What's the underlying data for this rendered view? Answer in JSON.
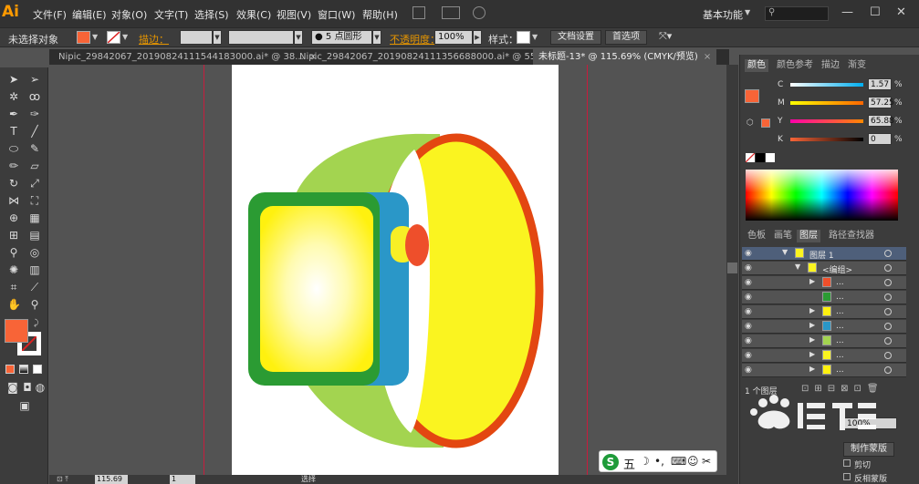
{
  "app": {
    "logo": "Ai"
  },
  "menu": [
    "文件(F)",
    "编辑(E)",
    "对象(O)",
    "文字(T)",
    "选择(S)",
    "效果(C)",
    "视图(V)",
    "窗口(W)",
    "帮助(H)"
  ],
  "workspace": "基本功能",
  "control": {
    "no_selection": "未选择对象",
    "stroke_label": "描边：",
    "brush_value": "5 点圆形",
    "opacity_label": "不透明度：",
    "opacity_value": "100%",
    "style_label": "样式：",
    "doc_settings": "文档设置",
    "preferences": "首选项"
  },
  "tabs": [
    {
      "label": "Nipic_29842067_20190824111544183000.ai* @ 38..."
    },
    {
      "label": "Nipic_29842067_20190824111356688000.ai* @ 55..."
    },
    {
      "label": "未标题-13* @ 115.69% (CMYK/预览)"
    }
  ],
  "color_panel": {
    "tabs": [
      "颜色",
      "颜色参考",
      "描边",
      "渐变"
    ],
    "channels": [
      {
        "name": "C",
        "value": "1.57",
        "unit": "%"
      },
      {
        "name": "M",
        "value": "57.25",
        "unit": "%"
      },
      {
        "name": "Y",
        "value": "65.88",
        "unit": "%"
      },
      {
        "name": "K",
        "value": "0",
        "unit": "%"
      }
    ]
  },
  "layers_panel": {
    "tabs": [
      "色板",
      "画笔",
      "图层",
      "路径查找器"
    ],
    "rows": [
      {
        "label": "图层 1"
      },
      {
        "label": "<编组>"
      },
      {
        "label": "..."
      },
      {
        "label": "..."
      },
      {
        "label": "..."
      },
      {
        "label": "..."
      },
      {
        "label": "..."
      },
      {
        "label": "..."
      },
      {
        "label": "..."
      }
    ],
    "footer": "1 个图层"
  },
  "transparency": {
    "value": "100%",
    "mask_button": "制作蒙版",
    "clip": "剪切",
    "invert": "反相蒙版"
  },
  "statusbar": {
    "zoom": "115.69",
    "page": "1",
    "mode": "选择"
  },
  "ime": {
    "label": "五"
  },
  "colors": {
    "fill": "#f86437",
    "band_green": "#a3d450",
    "band_yellow": "#faf420",
    "band_red": "#e34711",
    "case_blue": "#2a97c8",
    "bezel_green": "#2b9b33",
    "screen_yellow": "#fff10f",
    "crown_red": "#ee4f2b",
    "crown_yellow": "#f7ef26"
  }
}
